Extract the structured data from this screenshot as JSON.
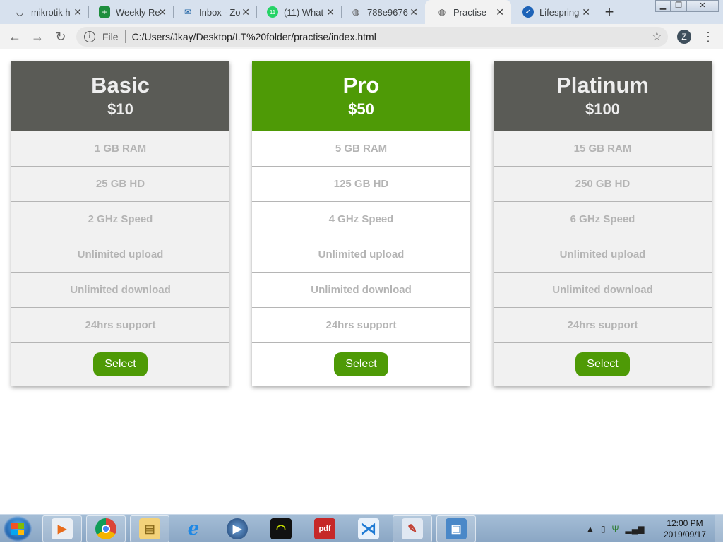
{
  "browser": {
    "tabs": [
      {
        "title": "mikrotik h",
        "icon": "mikrotik-icon"
      },
      {
        "title": "Weekly Re",
        "icon": "sheets-icon"
      },
      {
        "title": "Inbox - Zo",
        "icon": "mail-icon"
      },
      {
        "title": "(11) What",
        "icon": "whatsapp-icon",
        "badge": "11"
      },
      {
        "title": "788e9676",
        "icon": "globe-icon"
      },
      {
        "title": "Practise",
        "icon": "globe-icon"
      },
      {
        "title": "Lifespring",
        "icon": "lifespring-icon"
      }
    ],
    "active_tab_index": 5,
    "address": {
      "scheme": "File",
      "url": "C:/Users/Jkay/Desktop/I.T%20folder/practise/index.html"
    },
    "profile_initial": "Z"
  },
  "pricing": {
    "plans": [
      {
        "name": "Basic",
        "price": "$10",
        "features": [
          "1 GB RAM",
          "25 GB HD",
          "2 GHz Speed",
          "Unlimited upload",
          "Unlimited download",
          "24hrs support"
        ],
        "button": "Select"
      },
      {
        "name": "Pro",
        "price": "$50",
        "features": [
          "5 GB RAM",
          "125 GB HD",
          "4 GHz Speed",
          "Unlimited upload",
          "Unlimited download",
          "24hrs support"
        ],
        "button": "Select"
      },
      {
        "name": "Platinum",
        "price": "$100",
        "features": [
          "15 GB RAM",
          "250 GB HD",
          "6 GHz Speed",
          "Unlimited upload",
          "Unlimited download",
          "24hrs support"
        ],
        "button": "Select"
      }
    ],
    "colors": {
      "header_dark": "#5a5b56",
      "accent_green": "#4e9a06"
    }
  },
  "taskbar": {
    "apps": [
      "media-player-icon",
      "chrome-icon",
      "file-explorer-icon",
      "internet-explorer-icon",
      "windows-media-player-icon",
      "app-icon",
      "pdf-icon",
      "vscode-icon",
      "paint-icon",
      "photo-viewer-icon"
    ],
    "clock": {
      "time": "12:00 PM",
      "date": "2019/09/17"
    }
  }
}
